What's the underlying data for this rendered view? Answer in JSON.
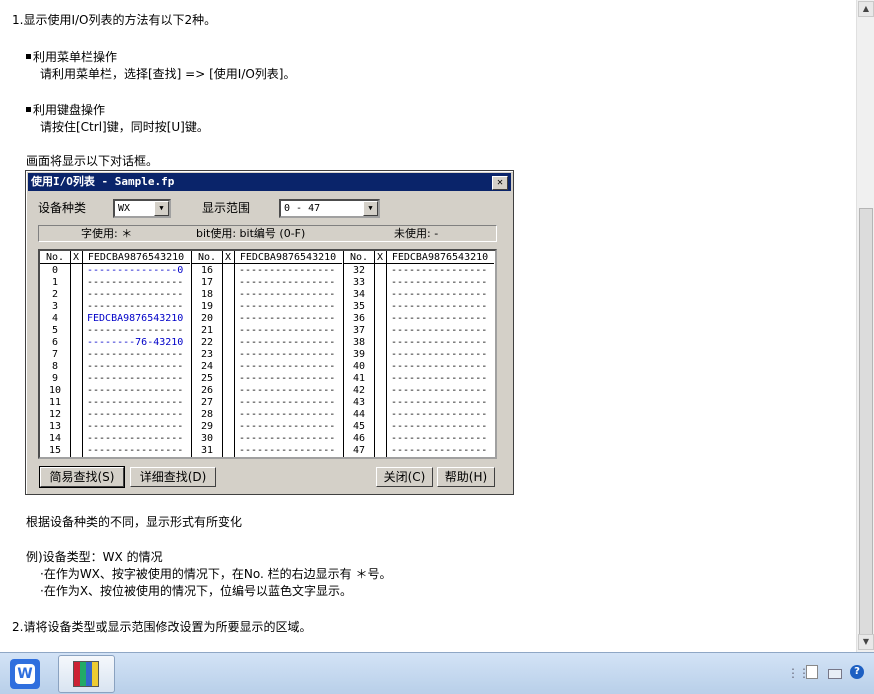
{
  "doc": {
    "step1": "1.显示使用I/O列表的方法有以下2种。",
    "menu_heading": "利用菜单栏操作",
    "menu_text": "请利用菜单栏，选择[查找] => [使用I/O列表]。",
    "key_heading": "利用键盘操作",
    "key_text": "请按住[Ctrl]键，同时按[U]键。",
    "dialog_intro": "画面将显示以下对话框。",
    "varies_text": "根据设备种类的不同，显示形式有所变化",
    "example_heading": "例)设备类型：WX 的情况",
    "example_line1": "·在作为WX、按字被使用的情况下，在No. 栏的右边显示有 ＊号。",
    "example_line2": "·在作为X、按位被使用的情况下，位编号以蓝色文字显示。",
    "step2": "2.请将设备类型或显示范围修改设置为所要显示的区域。"
  },
  "dialog": {
    "title": "使用I/O列表 - Sample.fp",
    "close_glyph": "✕",
    "device_label": "设备种类",
    "device_value": "WX",
    "range_label": "显示范围",
    "range_value": "0 - 47",
    "legend_word": "字使用:  ＊",
    "legend_bit": "bit使用:  bit编号 (0-F)",
    "legend_unused": "未使用:  -",
    "col_no": "No.",
    "col_x": "X",
    "col_bits": "FEDCBA9876543210",
    "columns": [
      {
        "nos": [
          "0",
          "1",
          "2",
          "3",
          "4",
          "5",
          "6",
          "7",
          "8",
          "9",
          "10",
          "11",
          "12",
          "13",
          "14",
          "15"
        ],
        "bits": [
          "---------------0",
          "----------------",
          "----------------",
          "----------------",
          "FEDCBA9876543210",
          "----------------",
          "--------76-43210",
          "----------------",
          "----------------",
          "----------------",
          "----------------",
          "----------------",
          "----------------",
          "----------------",
          "----------------",
          "----------------"
        ],
        "blue": [
          true,
          false,
          false,
          false,
          true,
          false,
          true,
          false,
          false,
          false,
          false,
          false,
          false,
          false,
          false,
          false
        ]
      },
      {
        "nos": [
          "16",
          "17",
          "18",
          "19",
          "20",
          "21",
          "22",
          "23",
          "24",
          "25",
          "26",
          "27",
          "28",
          "29",
          "30",
          "31"
        ],
        "bits": [
          "----------------",
          "----------------",
          "----------------",
          "----------------",
          "----------------",
          "----------------",
          "----------------",
          "----------------",
          "----------------",
          "----------------",
          "----------------",
          "----------------",
          "----------------",
          "----------------",
          "----------------",
          "----------------"
        ],
        "blue": [
          false,
          false,
          false,
          false,
          false,
          false,
          false,
          false,
          false,
          false,
          false,
          false,
          false,
          false,
          false,
          false
        ]
      },
      {
        "nos": [
          "32",
          "33",
          "34",
          "35",
          "36",
          "37",
          "38",
          "39",
          "40",
          "41",
          "42",
          "43",
          "44",
          "45",
          "46",
          "47"
        ],
        "bits": [
          "----------------",
          "----------------",
          "----------------",
          "----------------",
          "----------------",
          "----------------",
          "----------------",
          "----------------",
          "----------------",
          "----------------",
          "----------------",
          "----------------",
          "----------------",
          "----------------",
          "----------------",
          "----------------"
        ],
        "blue": [
          false,
          false,
          false,
          false,
          false,
          false,
          false,
          false,
          false,
          false,
          false,
          false,
          false,
          false,
          false,
          false
        ]
      }
    ],
    "btn_simple": "简易查找(S)",
    "btn_detail": "详细查找(D)",
    "btn_close": "关闭(C)",
    "btn_help": "帮助(H)"
  },
  "taskbar": {
    "wps_glyph": "W",
    "tray_help": "?"
  },
  "colors": {
    "title_bar": "#0a246a",
    "blue_bits": "#0000c8",
    "dialog_face": "#d4d0c8"
  }
}
